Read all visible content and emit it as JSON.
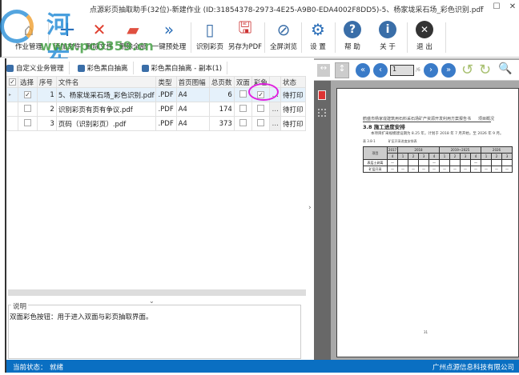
{
  "window": {
    "title": "点源彩页抽取助手(32位)-新建作业 (ID:31854378-2973-4E25-A9B0-EDA4002F8DD5)-5、杨家垅采石场_彩色识别.pdf",
    "minimize": "–",
    "maximize": "☐",
    "close": "✕"
  },
  "watermark": {
    "name": "河东软件园",
    "url": "www.pc0359.cn"
  },
  "toolbar": [
    {
      "label": "作业管理",
      "icon": "home-icon"
    },
    {
      "label": "添加文件",
      "icon": "plus-icon"
    },
    {
      "label": "删除文件",
      "icon": "x-icon"
    },
    {
      "label": "删除全部",
      "icon": "eraser-icon"
    },
    {
      "label": "一键预处理",
      "icon": "double-chevron-icon"
    },
    {
      "label": "识别彩页",
      "icon": "pages-icon"
    },
    {
      "label": "另存为PDF",
      "icon": "pdf-save-icon"
    },
    {
      "label": "全屏浏览",
      "icon": "compass-icon"
    },
    {
      "label": "设 置",
      "icon": "gear-icon"
    },
    {
      "label": "帮 助",
      "icon": "help-icon"
    },
    {
      "label": "关 于",
      "icon": "info-icon"
    },
    {
      "label": "退 出",
      "icon": "exit-icon"
    }
  ],
  "tabs": [
    {
      "label": "自定义业务管理"
    },
    {
      "label": "彩色黑白抽离"
    },
    {
      "label": "彩色黑白抽离 - 副本(1)"
    }
  ],
  "table": {
    "headers": [
      "选择",
      "序号",
      "文件名",
      "类型",
      "首页图幅",
      "总页数",
      "双面",
      "彩色",
      "",
      "状态"
    ],
    "rows": [
      {
        "selected": true,
        "no": "1",
        "name": "5、杨家垅采石场_彩色识别.pdf",
        "type": ".PDF",
        "size": "A4",
        "pages": "6",
        "duplex": false,
        "color": true,
        "status": "待打印"
      },
      {
        "selected": false,
        "no": "2",
        "name": "识别彩页有页有争议.pdf",
        "type": ".PDF",
        "size": "A4",
        "pages": "174",
        "duplex": false,
        "color": false,
        "status": "待打印"
      },
      {
        "selected": false,
        "no": "3",
        "name": "页码（识别彩页）.pdf",
        "type": ".PDF",
        "size": "A4",
        "pages": "373",
        "duplex": false,
        "color": false,
        "status": "待打印"
      }
    ]
  },
  "description": {
    "label": "说明",
    "text": "双面彩色按钮：用于进入双面与彩页抽取界面。"
  },
  "viewer": {
    "page": "1",
    "total": "/6"
  },
  "document": {
    "header_left": "鹤盛市杨家垅建筑用石料采石场矿产资源开发利用方案报告书",
    "header_right": "项目概况",
    "heading": "3.8 施工进度安排",
    "para": "本项目扩采规模建设期为 8.25 年，计划于 2018 年 7 月开始，至 2026 年 9 月。",
    "table_caption": "表 3.8-1　　　　矿区开采进度安排表",
    "col_project": "项目",
    "years": [
      "2017",
      "2018",
      "2019~2025",
      "2026"
    ],
    "rows": [
      "表层土剥离",
      "矿层开采"
    ],
    "page_no": "31"
  },
  "status": {
    "label": "当前状态：",
    "value": "就绪",
    "company": "广州点源信息科技有限公司"
  },
  "colors": {
    "accent": "#0a6fc2",
    "highlight": "#e020e0",
    "nav": "#3a7bc8"
  }
}
